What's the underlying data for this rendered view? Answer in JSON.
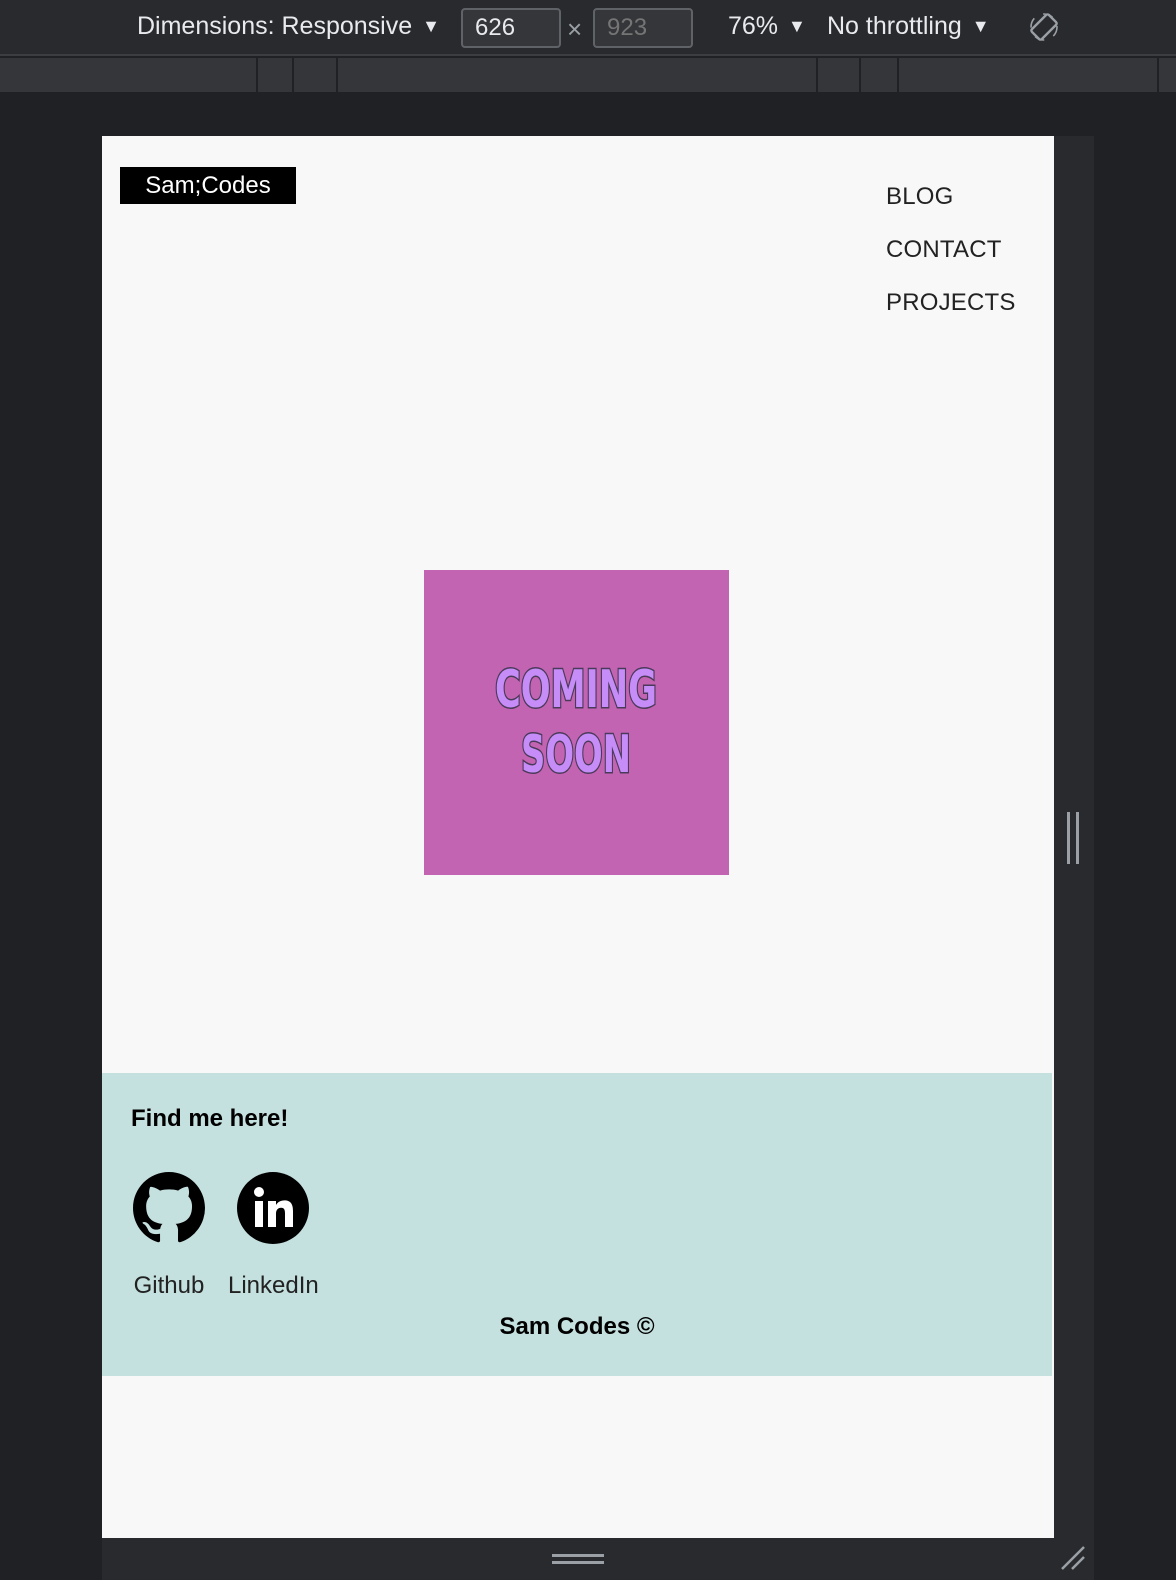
{
  "devtools": {
    "dimensions_label": "Dimensions: Responsive",
    "width_value": "626",
    "height_placeholder": "923",
    "times": "×",
    "zoom": "76%",
    "throttling": "No throttling",
    "caret": "▼"
  },
  "header": {
    "logo": "Sam;Codes",
    "nav": [
      "BLOG",
      "CONTACT",
      "PROJECTS"
    ]
  },
  "hero": {
    "line1": "COMING",
    "line2": "SOON",
    "bg_color": "#c364b3",
    "text_color": "#c68cf7"
  },
  "footer": {
    "title": "Find me here!",
    "links": [
      {
        "label": "Github",
        "icon": "github-icon"
      },
      {
        "label": "LinkedIn",
        "icon": "linkedin-icon"
      }
    ],
    "copyright": "Sam Codes ©",
    "bg_color": "#c4e0df"
  }
}
